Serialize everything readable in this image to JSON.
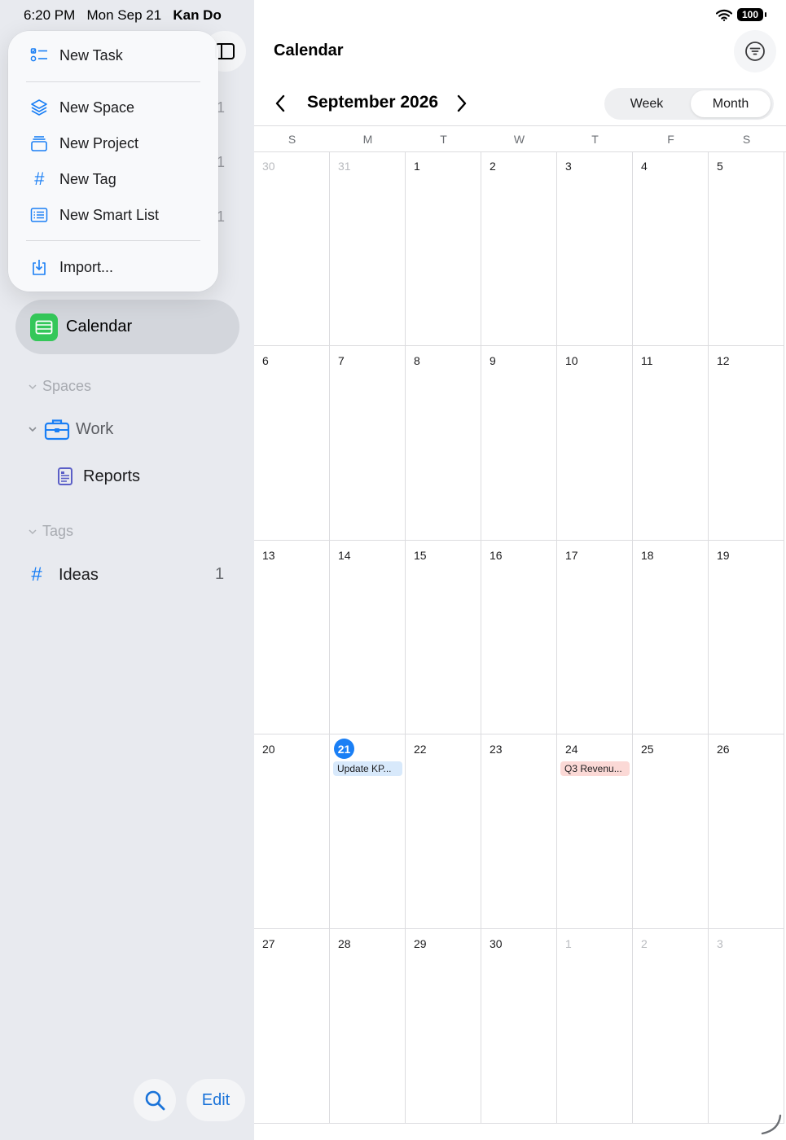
{
  "status_bar": {
    "time": "6:20 PM",
    "date": "Mon Sep 21",
    "user": "Kan Do",
    "battery": "100"
  },
  "popup_menu": {
    "items": [
      {
        "label": "New Task",
        "icon": "task-list-icon"
      },
      {
        "label": "New Space",
        "icon": "layers-icon"
      },
      {
        "label": "New Project",
        "icon": "project-box-icon"
      },
      {
        "label": "New Tag",
        "icon": "hashtag-icon"
      },
      {
        "label": "New Smart List",
        "icon": "smart-list-icon"
      },
      {
        "label": "Import...",
        "icon": "import-tray-icon"
      }
    ]
  },
  "sidebar": {
    "ghost_counts": [
      "1",
      "1",
      "1"
    ],
    "selected_item": {
      "label": "Calendar",
      "icon": "calendar-app-icon"
    },
    "spaces_header": "Spaces",
    "work": {
      "label": "Work",
      "icon": "briefcase-icon"
    },
    "reports": {
      "label": "Reports",
      "icon": "document-icon"
    },
    "tags_header": "Tags",
    "ideas": {
      "label": "Ideas",
      "count": "1",
      "icon": "hashtag-icon"
    },
    "edit_label": "Edit"
  },
  "main": {
    "title": "Calendar",
    "month_title": "September 2026",
    "segmented": {
      "week": "Week",
      "month": "Month",
      "selected": "Month"
    },
    "weekdays": [
      "S",
      "M",
      "T",
      "W",
      "T",
      "F",
      "S"
    ]
  },
  "calendar": {
    "weeks": [
      [
        {
          "d": "30",
          "other": true
        },
        {
          "d": "31",
          "other": true
        },
        {
          "d": "1"
        },
        {
          "d": "2"
        },
        {
          "d": "3"
        },
        {
          "d": "4"
        },
        {
          "d": "5"
        }
      ],
      [
        {
          "d": "6"
        },
        {
          "d": "7"
        },
        {
          "d": "8"
        },
        {
          "d": "9"
        },
        {
          "d": "10"
        },
        {
          "d": "11"
        },
        {
          "d": "12"
        }
      ],
      [
        {
          "d": "13"
        },
        {
          "d": "14"
        },
        {
          "d": "15"
        },
        {
          "d": "16"
        },
        {
          "d": "17"
        },
        {
          "d": "18"
        },
        {
          "d": "19"
        }
      ],
      [
        {
          "d": "20"
        },
        {
          "d": "21",
          "today": true,
          "event": "Update KP...",
          "event_color": "blue"
        },
        {
          "d": "22"
        },
        {
          "d": "23"
        },
        {
          "d": "24",
          "event": "Q3 Revenu...",
          "event_color": "red"
        },
        {
          "d": "25"
        },
        {
          "d": "26"
        }
      ],
      [
        {
          "d": "27"
        },
        {
          "d": "28"
        },
        {
          "d": "29"
        },
        {
          "d": "30"
        },
        {
          "d": "1",
          "other": true
        },
        {
          "d": "2",
          "other": true
        },
        {
          "d": "3",
          "other": true
        }
      ]
    ]
  },
  "colors": {
    "accent": "#1a7ff5",
    "calendar_icon_bg": "#34c759",
    "event_blue": "#d8e9fb",
    "event_red": "#fbd9d6"
  }
}
